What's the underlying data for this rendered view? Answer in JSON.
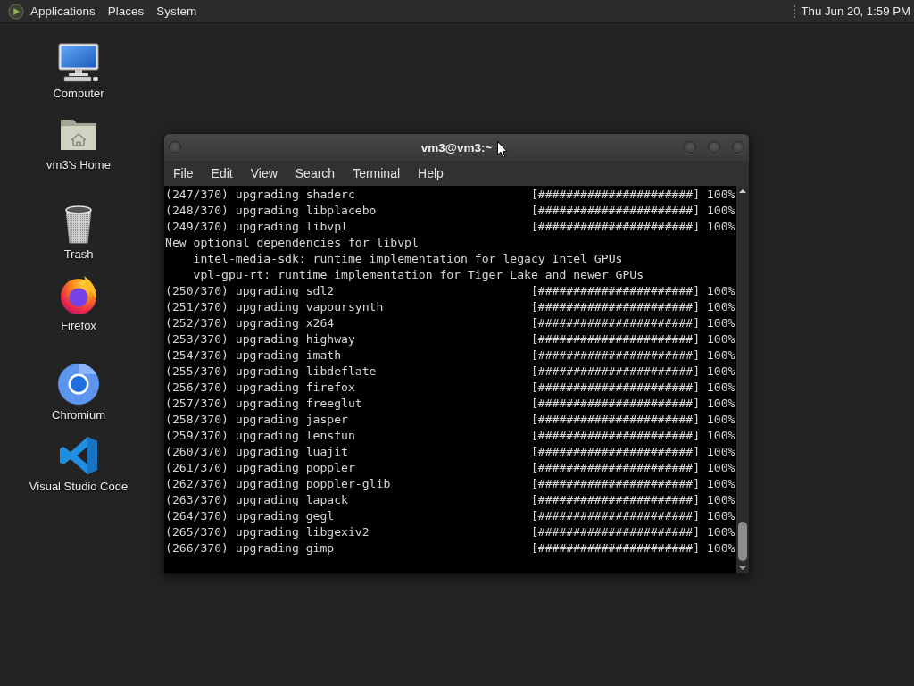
{
  "top_panel": {
    "menus": [
      "Applications",
      "Places",
      "System"
    ],
    "clock": "Thu Jun 20, 1:59 PM"
  },
  "desktop_icons": [
    {
      "kind": "computer",
      "label": "Computer"
    },
    {
      "kind": "folder",
      "label": "vm3's Home"
    },
    {
      "kind": "trash",
      "label": "Trash"
    },
    {
      "kind": "firefox",
      "label": "Firefox"
    },
    {
      "kind": "chromium",
      "label": "Chromium"
    },
    {
      "kind": "vscode",
      "label": "Visual Studio Code"
    }
  ],
  "terminal_window": {
    "title": "vm3@vm3:~",
    "menu": [
      "File",
      "Edit",
      "View",
      "Search",
      "Terminal",
      "Help"
    ],
    "lines": [
      {
        "kind": "progress",
        "text": "(247/370) upgrading shaderc",
        "bar": "[######################]",
        "percent": "100%"
      },
      {
        "kind": "progress",
        "text": "(248/370) upgrading libplacebo",
        "bar": "[######################]",
        "percent": "100%"
      },
      {
        "kind": "progress",
        "text": "(249/370) upgrading libvpl",
        "bar": "[######################]",
        "percent": "100%"
      },
      {
        "kind": "text",
        "text": "New optional dependencies for libvpl",
        "children": [
          {
            "kind": "text",
            "text": "intel-media-sdk: runtime implementation for legacy Intel GPUs"
          },
          {
            "kind": "text",
            "text": "vpl-gpu-rt: runtime implementation for Tiger Lake and newer GPUs"
          }
        ]
      },
      {
        "kind": "progress",
        "text": "(250/370) upgrading sdl2",
        "bar": "[######################]",
        "percent": "100%"
      },
      {
        "kind": "progress",
        "text": "(251/370) upgrading vapoursynth",
        "bar": "[######################]",
        "percent": "100%"
      },
      {
        "kind": "progress",
        "text": "(252/370) upgrading x264",
        "bar": "[######################]",
        "percent": "100%"
      },
      {
        "kind": "progress",
        "text": "(253/370) upgrading highway",
        "bar": "[######################]",
        "percent": "100%"
      },
      {
        "kind": "progress",
        "text": "(254/370) upgrading imath",
        "bar": "[######################]",
        "percent": "100%"
      },
      {
        "kind": "progress",
        "text": "(255/370) upgrading libdeflate",
        "bar": "[######################]",
        "percent": "100%"
      },
      {
        "kind": "progress",
        "text": "(256/370) upgrading firefox",
        "bar": "[######################]",
        "percent": "100%"
      },
      {
        "kind": "progress",
        "text": "(257/370) upgrading freeglut",
        "bar": "[######################]",
        "percent": "100%"
      },
      {
        "kind": "progress",
        "text": "(258/370) upgrading jasper",
        "bar": "[######################]",
        "percent": "100%"
      },
      {
        "kind": "progress",
        "text": "(259/370) upgrading lensfun",
        "bar": "[######################]",
        "percent": "100%"
      },
      {
        "kind": "progress",
        "text": "(260/370) upgrading luajit",
        "bar": "[######################]",
        "percent": "100%"
      },
      {
        "kind": "progress",
        "text": "(261/370) upgrading poppler",
        "bar": "[######################]",
        "percent": "100%"
      },
      {
        "kind": "progress",
        "text": "(262/370) upgrading poppler-glib",
        "bar": "[######################]",
        "percent": "100%"
      },
      {
        "kind": "progress",
        "text": "(263/370) upgrading lapack",
        "bar": "[######################]",
        "percent": "100%"
      },
      {
        "kind": "progress",
        "text": "(264/370) upgrading gegl",
        "bar": "[######################]",
        "percent": "100%"
      },
      {
        "kind": "progress",
        "text": "(265/370) upgrading libgexiv2",
        "bar": "[######################]",
        "percent": "100%"
      },
      {
        "kind": "progress",
        "text": "(266/370) upgrading gimp",
        "bar": "[######################]",
        "percent": "100%"
      }
    ]
  }
}
